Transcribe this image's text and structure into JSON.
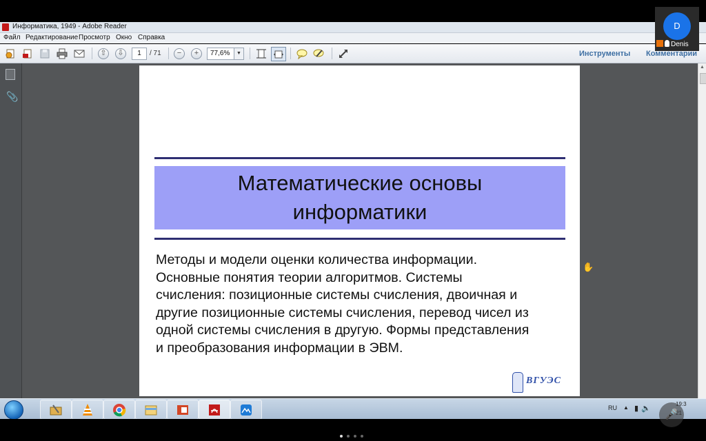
{
  "call": {
    "avatar_initial": "D",
    "participant_name": "Denis"
  },
  "window": {
    "title": "Информатика, 1949 - Adobe Reader"
  },
  "menu": [
    "Файл",
    "Редактирование",
    "Просмотр",
    "Окно",
    "Справка"
  ],
  "toolbar": {
    "page_current": "1",
    "page_total": "/ 71",
    "zoom": "77,6%",
    "tools_label": "Инструменты",
    "comments_label": "Комментарии"
  },
  "document": {
    "title_line1": "Математические основы",
    "title_line2": "информатики",
    "body_lines": [
      "Методы и модели оценки количества информации.",
      "Основные понятия теории алгоритмов. Системы",
      "счисления: позиционные системы счисления, двоичная и",
      "другие позиционные системы счисления, перевод чисел из",
      "одной системы счисления в другую. Формы представления",
      "и преобразования информации в ЭВМ."
    ],
    "logo_text": "ВГУЭС",
    "title_band_color": "#9d9ff7",
    "rule_color": "#2e2e72"
  },
  "tray": {
    "lang": "RU",
    "time": "19:3",
    "date": "21"
  },
  "icons": {
    "taskbar": [
      "start-orb-icon",
      "folder-tools-icon",
      "vlc-icon",
      "chrome-icon",
      "file-explorer-icon",
      "powerpoint-icon",
      "adobe-reader-icon",
      "app-icon"
    ]
  },
  "pagination": {
    "active_index": 0,
    "count": 4
  }
}
